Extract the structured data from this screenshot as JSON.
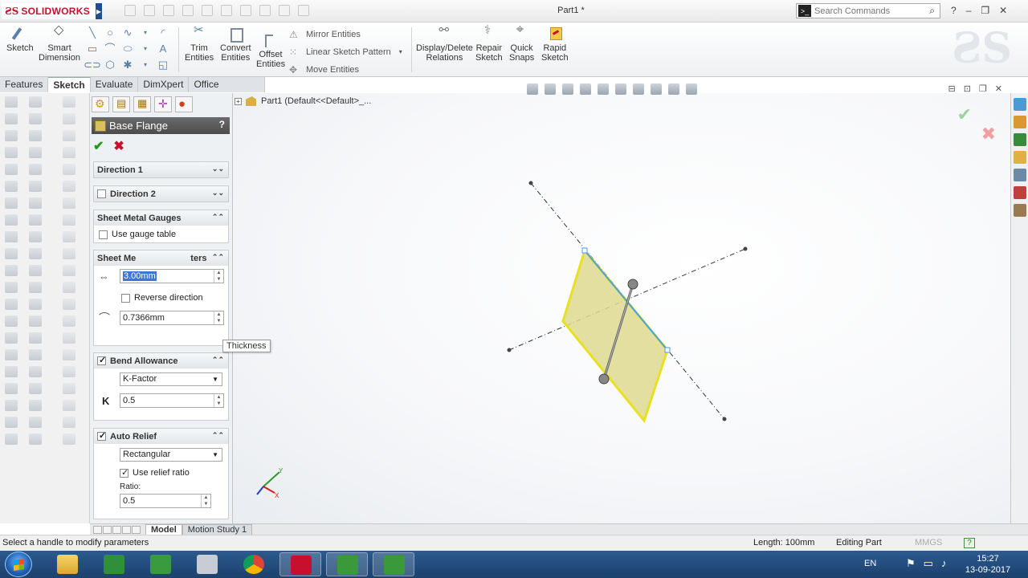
{
  "app": {
    "name": "SOLIDWORKS",
    "window_title": "Part1 *",
    "search_placeholder": "Search Commands"
  },
  "ribbon": {
    "sketch": "Sketch",
    "smart_dimension": [
      "Smart",
      "Dimension"
    ],
    "trim_entities": [
      "Trim",
      "Entities"
    ],
    "convert_entities": [
      "Convert",
      "Entities"
    ],
    "offset_entities": [
      "Offset",
      "Entities"
    ],
    "mirror_entities": "Mirror Entities",
    "linear_sketch_pattern": "Linear Sketch Pattern",
    "move_entities": "Move Entities",
    "display_delete_relations": [
      "Display/Delete",
      "Relations"
    ],
    "repair_sketch": [
      "Repair",
      "Sketch"
    ],
    "quick_snaps": [
      "Quick",
      "Snaps"
    ],
    "rapid_sketch": [
      "Rapid",
      "Sketch"
    ]
  },
  "tabs": [
    "Features",
    "Sketch",
    "Evaluate",
    "DimXpert",
    "Office Products"
  ],
  "active_tab": "Sketch",
  "property_manager": {
    "title": "Base Flange",
    "help": "?",
    "direction1": "Direction 1",
    "direction2": "Direction 2",
    "sheet_metal_gauges": "Sheet Metal Gauges",
    "use_gauge_table": "Use gauge table",
    "sheet_metal_parameters_visible": "Sheet Me",
    "sheet_metal_parameters_tail": "ters",
    "tooltip": "Thickness",
    "thickness_value": "3.00mm",
    "reverse_direction": "Reverse direction",
    "bend_radius_value": "0.7366mm",
    "bend_allowance": "Bend Allowance",
    "bend_allowance_type": "K-Factor",
    "k_label": "K",
    "k_value": "0.5",
    "auto_relief": "Auto Relief",
    "relief_type": "Rectangular",
    "use_relief_ratio": "Use relief ratio",
    "ratio_label": "Ratio:",
    "ratio_value": "0.5"
  },
  "feature_tree": {
    "root": "Part1  (Default<<Default>_..."
  },
  "triad": {
    "x": "X",
    "y": "Y"
  },
  "model_tabs": [
    "Model",
    "Motion Study 1"
  ],
  "active_model_tab": "Model",
  "status": {
    "message": "Select a handle to modify parameters",
    "length": "Length: 100mm",
    "mode": "Editing Part",
    "units": "MMGS",
    "help": "?"
  },
  "taskbar": {
    "language": "EN",
    "time": "15:27",
    "date": "13-09-2017"
  },
  "colors": {
    "brand_red": "#c8102e",
    "flange_fill": "#ded991",
    "flange_edge": "#e8e020",
    "selected_edge": "#4aa0e8",
    "selection_highlight": "#3a78d8"
  }
}
